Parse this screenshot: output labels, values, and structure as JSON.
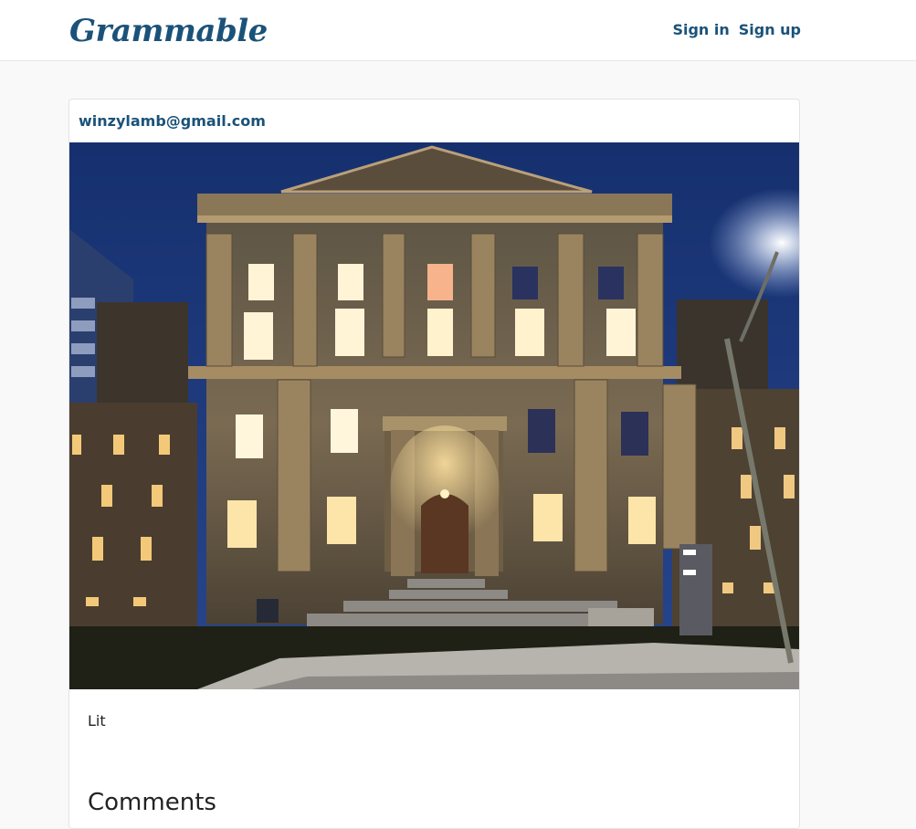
{
  "app": {
    "brand": "Grammable"
  },
  "nav": {
    "sign_in": "Sign in",
    "sign_up": "Sign up"
  },
  "post": {
    "author_email": "winzylamb@gmail.com",
    "caption": "Lit",
    "image_description_icon": "photo-icon"
  },
  "comments": {
    "heading": "Comments"
  },
  "colors": {
    "brand": "#1b5279",
    "background": "#f9f9f9",
    "card": "#ffffff"
  }
}
